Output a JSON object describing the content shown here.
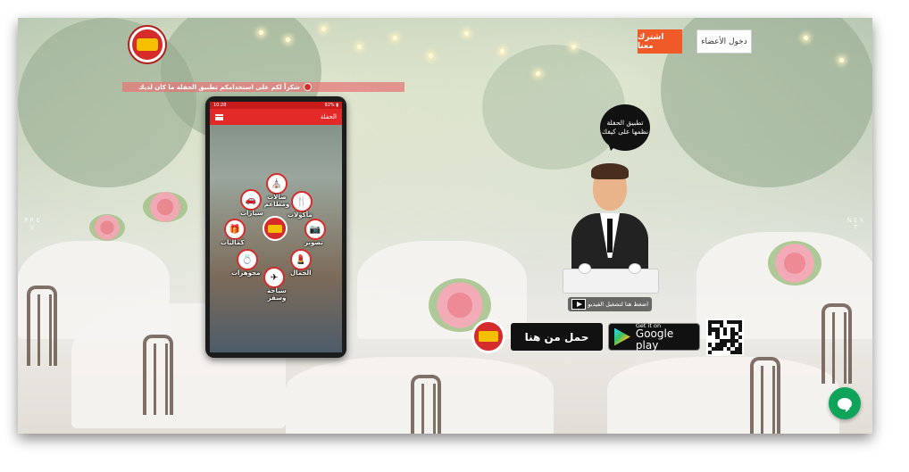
{
  "header": {
    "login_label": "دخول الأعضاء",
    "join_label": "اشترك معنا"
  },
  "ticker": {
    "text": "شكراً لكم على استخدامكم تطبيق الحفلة ما كان لديك"
  },
  "phone": {
    "status_time": "10:28",
    "status_right": "92% ▮",
    "app_title": "الحفلة",
    "categories": [
      {
        "label": "صالات ومطاعم",
        "icon": "hall-icon"
      },
      {
        "label": "سيارات",
        "icon": "car-icon"
      },
      {
        "label": "مأكولات",
        "icon": "food-icon"
      },
      {
        "label": "كماليات",
        "icon": "accessories-icon"
      },
      {
        "label": "تصوير",
        "icon": "camera-icon"
      },
      {
        "label": "مجوهرات",
        "icon": "jewelry-icon"
      },
      {
        "label": "الجمال",
        "icon": "beauty-icon"
      },
      {
        "label": "سياحة وسفر",
        "icon": "travel-icon"
      }
    ]
  },
  "bubble": {
    "line1": "تطبيق الحفلة",
    "line2": "نظمها على كيفك"
  },
  "video": {
    "label": "اضغط هنا لتشغيل الفيديو"
  },
  "download": {
    "button_label": "حمل من هنا",
    "gplay_small": "Get it on",
    "gplay_big": "Google play"
  },
  "slider": {
    "prev": "PREV",
    "next": "NEXT"
  },
  "colors": {
    "brand_red": "#d62b2b",
    "join_orange": "#f05a28",
    "chat_green": "#0ea55a"
  }
}
